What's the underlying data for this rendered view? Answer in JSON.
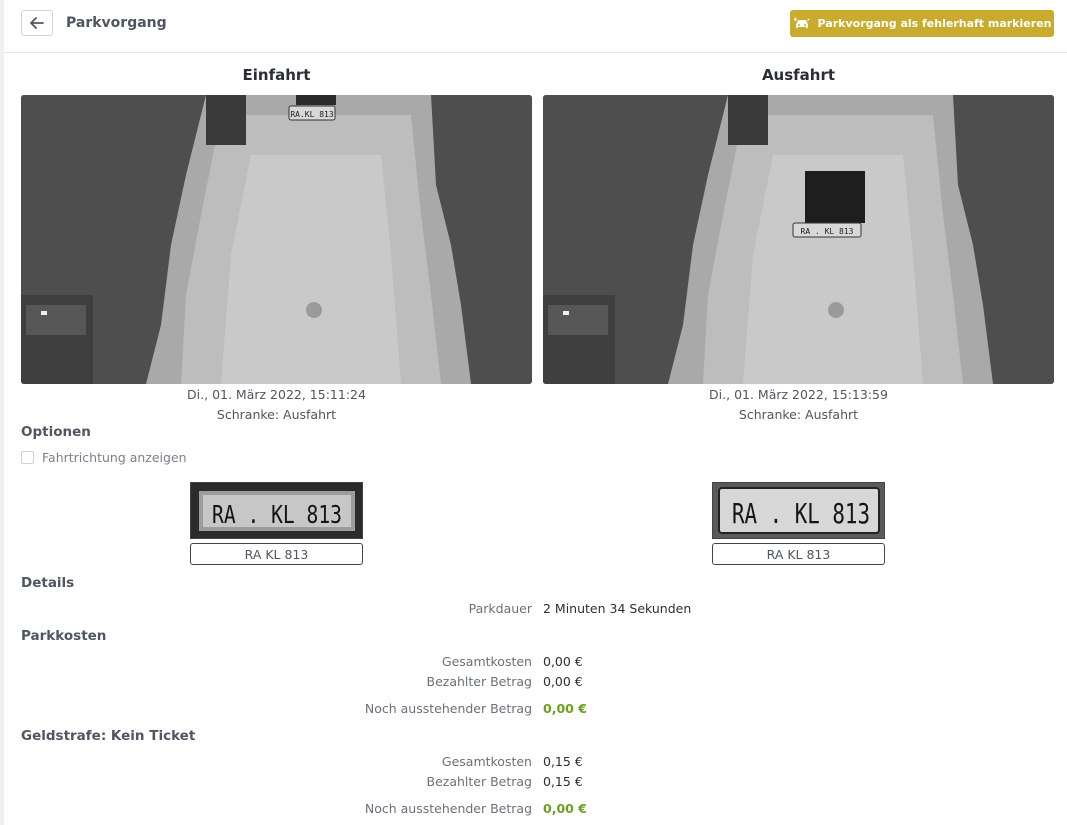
{
  "header": {
    "title": "Parkvorgang",
    "mark_button": "Parkvorgang als fehlerhaft markieren"
  },
  "entry": {
    "title": "Einfahrt",
    "timestamp": "Di., 01. März 2022, 15:11:24",
    "barrier": "Schranke: Ausfahrt",
    "plate_image_text": "RA . KL 813",
    "camera_plate_text": "RA.KL 813",
    "plate": "RA KL 813"
  },
  "exit": {
    "title": "Ausfahrt",
    "timestamp": "Di., 01. März 2022, 15:13:59",
    "barrier": "Schranke: Ausfahrt",
    "plate_image_text": "RA . KL 813",
    "camera_plate_text": "RA . KL 813",
    "plate": "RA KL 813"
  },
  "options": {
    "heading": "Optionen",
    "show_direction_label": "Fahrtrichtung anzeigen",
    "show_direction_checked": false
  },
  "details": {
    "heading": "Details",
    "duration_label": "Parkdauer",
    "duration_value": "2 Minuten 34 Sekunden"
  },
  "parking_costs": {
    "heading": "Parkkosten",
    "total_label": "Gesamtkosten",
    "total_value": "0,00 €",
    "paid_label": "Bezahlter Betrag",
    "paid_value": "0,00 €",
    "outstanding_label": "Noch ausstehender Betrag",
    "outstanding_value": "0,00 €"
  },
  "fine": {
    "heading": "Geldstrafe: Kein Ticket",
    "total_label": "Gesamtkosten",
    "total_value": "0,15 €",
    "paid_label": "Bezahlter Betrag",
    "paid_value": "0,15 €",
    "outstanding_label": "Noch ausstehender Betrag",
    "outstanding_value": "0,00 €"
  },
  "colors": {
    "accent_button": "#c9ac2e",
    "outstanding_green": "#6aa121"
  },
  "icons": {
    "back": "arrow-left-icon",
    "mark": "car-crash-icon"
  }
}
